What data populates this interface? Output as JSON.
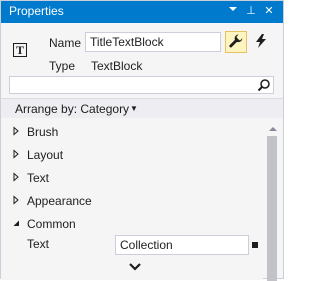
{
  "titlebar": {
    "title": "Properties",
    "pin_glyph": "⊥",
    "close_glyph": "✕"
  },
  "header": {
    "type_icon_glyph": "T",
    "name_label": "Name",
    "name_value": "TitleTextBlock",
    "type_label": "Type",
    "type_value": "TextBlock"
  },
  "search": {
    "value": "",
    "placeholder": ""
  },
  "arrange": {
    "label": "Arrange by: Category",
    "caret": "▼"
  },
  "categories": [
    {
      "label": "Brush",
      "expanded": false
    },
    {
      "label": "Layout",
      "expanded": false
    },
    {
      "label": "Text",
      "expanded": false
    },
    {
      "label": "Appearance",
      "expanded": false
    },
    {
      "label": "Common",
      "expanded": true
    }
  ],
  "common": {
    "text_label": "Text",
    "text_value": "Collection"
  },
  "colors": {
    "titlebar_bg": "#007acc",
    "active_tool_bg": "#fdf4bf",
    "active_tool_border": "#e5c365"
  },
  "icons": {
    "type": "textblock-type-icon",
    "properties_tool": "wrench-icon",
    "events_tool": "lightning-icon",
    "search": "magnifier-icon",
    "collapsed": "triangle-right-icon",
    "expanded": "triangle-down-icon",
    "more": "chevron-down-icon"
  }
}
